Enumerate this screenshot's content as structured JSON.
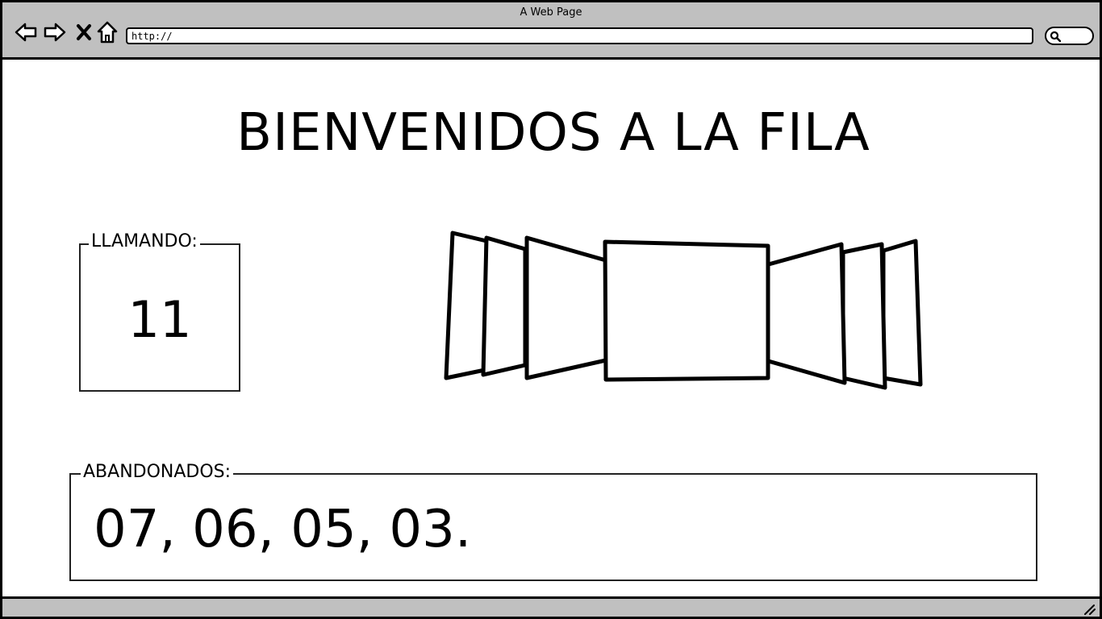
{
  "browser": {
    "title": "A Web Page",
    "url": "http://",
    "icons": [
      "back-arrow-icon",
      "forward-arrow-icon",
      "close-icon",
      "home-icon",
      "search-icon"
    ]
  },
  "page": {
    "heading": "BIENVENIDOS A LA FILA",
    "calling": {
      "label": "LLAMANDO:",
      "number": "11"
    },
    "carousel": {
      "icon": "cover-flow-image-carousel"
    },
    "abandoned": {
      "label": "ABANDONADOS:",
      "list": "07, 06, 05, 03."
    }
  }
}
